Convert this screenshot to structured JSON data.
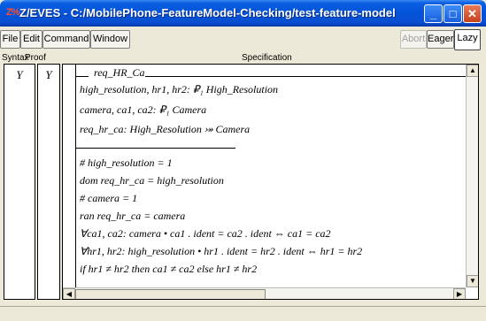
{
  "window": {
    "icon": "Z%",
    "title": "Z/EVES - C:/MobilePhone-FeatureModel-Checking/test-feature-model",
    "minimize_label": "_",
    "maximize_label": "□",
    "close_label": "✕"
  },
  "toolbar": {
    "file": "File",
    "edit": "Edit",
    "command": "Command",
    "window": "Window",
    "abort": "Abort",
    "eager": "Eager",
    "lazy": "Lazy"
  },
  "columns": {
    "syntax": "Syntax",
    "proof": "Proof",
    "specification": "Specification"
  },
  "status": {
    "syntax": "Y",
    "proof": "Y"
  },
  "schema": {
    "name": "req_HR_Ca",
    "declarations": [
      "high_resolution, hr1, hr2: ₽₁ High_Resolution",
      "camera, ca1, ca2: ₽₁ Camera",
      "req_hr_ca: High_Resolution ⤖ Camera"
    ],
    "predicates": [
      "# high_resolution = 1",
      "dom req_hr_ca = high_resolution",
      "# camera = 1",
      "ran req_hr_ca = camera",
      "∀ca1, ca2: camera • ca1 . ident = ca2 . ident ⇔ ca1 = ca2",
      "∀hr1, hr2: high_resolution • hr1 . ident = hr2 . ident ⇔ hr1 = hr2",
      "if hr1 ≠ hr2 then ca1 ≠ ca2 else hr1 ≠ hr2"
    ]
  },
  "scroll": {
    "up": "▲",
    "down": "▼",
    "left": "◀",
    "right": "▶"
  },
  "colors": {
    "titlebar": "#0453d8",
    "close_button": "#c6421c",
    "chrome": "#ece9d8"
  }
}
